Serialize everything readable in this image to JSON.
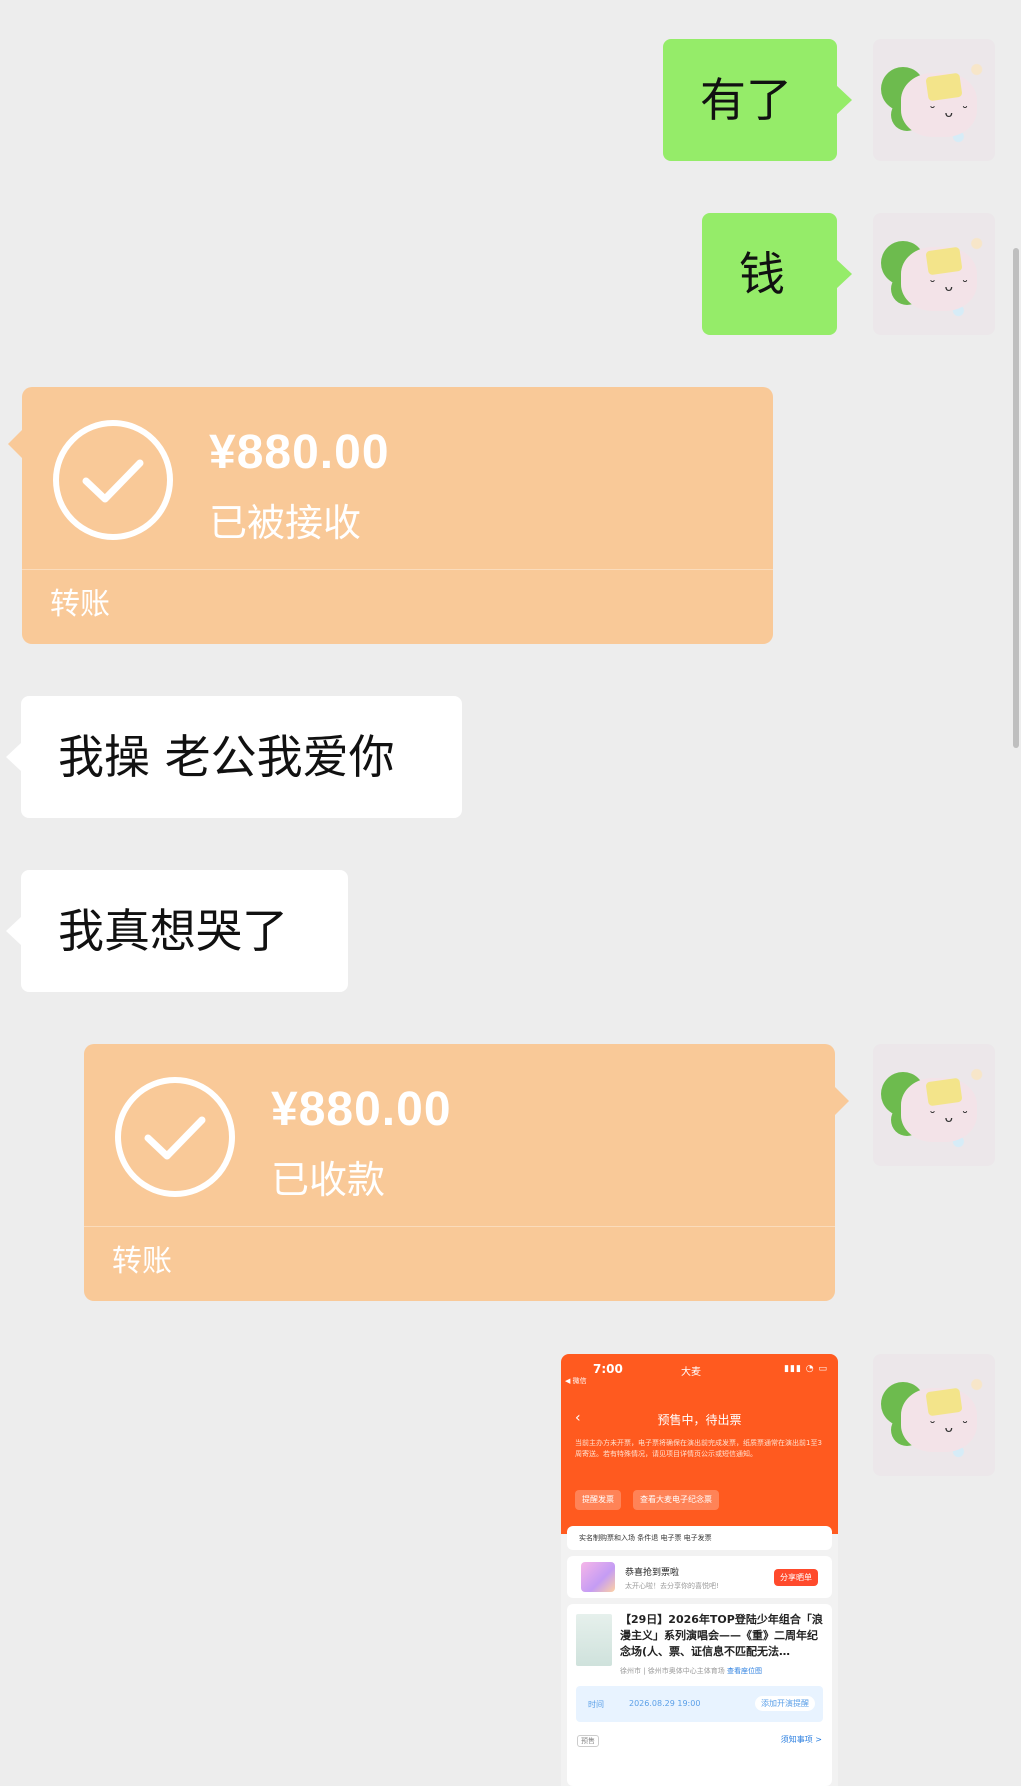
{
  "chat": {
    "messages": [
      {
        "side": "right",
        "text": "有了"
      },
      {
        "side": "right",
        "text": "钱"
      },
      {
        "side": "left",
        "transfer": {
          "amount": "¥880.00",
          "status": "已被接收",
          "kind": "转账"
        }
      },
      {
        "side": "left",
        "text": "我操 老公我爱你"
      },
      {
        "side": "left",
        "text": "我真想哭了"
      },
      {
        "side": "right",
        "transfer": {
          "amount": "¥880.00",
          "status": "已收款",
          "kind": "转账"
        }
      },
      {
        "side": "right",
        "image": "ticket-order-screenshot"
      }
    ]
  },
  "screenshot": {
    "time": "7:00",
    "carrier": "◀ 微信",
    "brand": "大麦",
    "order_status": "预售中，待出票",
    "notice": "当前主办方未开票，电子票将确保在演出前完成发票，纸质票通常在演出前1至3周寄送。若有特殊情况，请见项目详情页公示或短信通知。",
    "btn_invoice": "提醒发票",
    "btn_souvenir": "查看大麦电子纪念票",
    "tags": "实名制购票和入场   条件退   电子票   电子发票",
    "grab_title": "恭喜抢到票啦",
    "grab_sub": "太开心啦！去分享你的喜悦吧!",
    "share_btn": "分享晒单",
    "event_title": "【29日】2026年TOP登陆少年组合「浪漫主义」系列演唱会——《重》二周年纪念场(人、票、证信息不匹配无法…",
    "location": "徐州市 | 徐州市奥体中心主体育场",
    "map_link": "查看座位图",
    "time_label": "时间",
    "time_value": "2026.08.29 19:00",
    "reminder": "添加开演提醒",
    "presale": "预售",
    "notice_link": "须知事项 >"
  },
  "colors": {
    "background": "#ededed",
    "green_bubble": "#95ec69",
    "transfer": "#f9c998",
    "damai_orange": "#ff5a1f"
  }
}
